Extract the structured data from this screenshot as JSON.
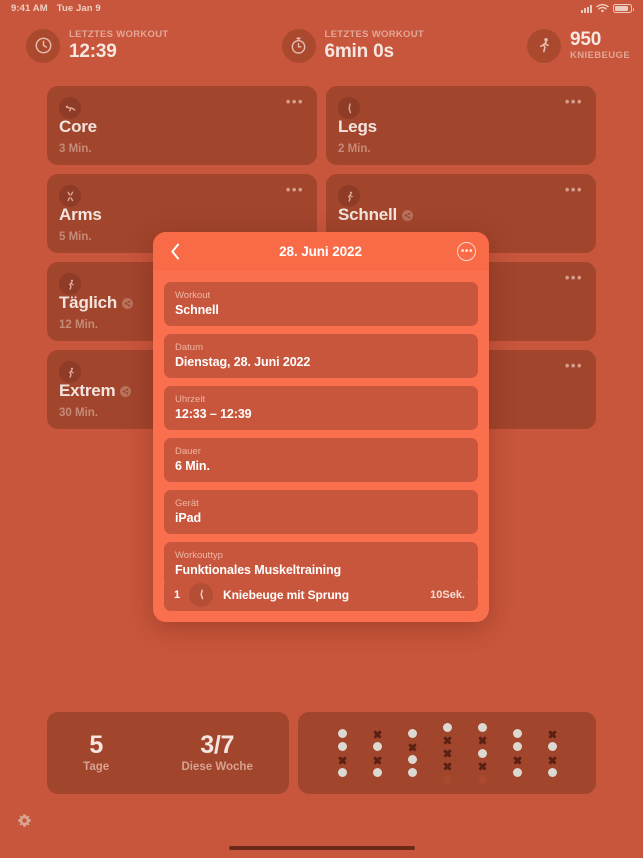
{
  "status_bar": {
    "time": "9:41 AM",
    "date": "Tue Jan 9",
    "icons": [
      "cellular-signal-icon",
      "wifi-icon",
      "battery-icon"
    ]
  },
  "top_stats": [
    {
      "icon": "clock-icon",
      "label": "LETZTES WORKOUT",
      "value": "12:39"
    },
    {
      "icon": "stopwatch-icon",
      "label": "LETZTES WORKOUT",
      "value": "6min 0s"
    },
    {
      "icon": "runner-icon",
      "value": "950",
      "label": "KNIEBEUGE"
    }
  ],
  "workout_cards": [
    {
      "icon": "plank-icon",
      "title": "Core",
      "duration": "3 Min.",
      "shared": false,
      "menu": "•••"
    },
    {
      "icon": "leg-raise-icon",
      "title": "Legs",
      "duration": "2 Min.",
      "shared": false,
      "menu": "•••"
    },
    {
      "icon": "arms-icon",
      "title": "Arms",
      "duration": "5 Min.",
      "shared": false,
      "menu": "•••"
    },
    {
      "icon": "squat-jump-icon",
      "title": "Schnell",
      "duration": "",
      "shared": true,
      "menu": "•••"
    },
    {
      "icon": "squat-jump-icon",
      "title": "Täglich",
      "duration": "12 Min.",
      "shared": true,
      "menu": "•••"
    },
    {
      "icon": "squat-jump-icon",
      "title": "Extrem",
      "duration": "30 Min.",
      "shared": true,
      "menu": "•••"
    }
  ],
  "modal": {
    "title": "28. Juni 2022",
    "back_icon": "chevron-left-icon",
    "more_icon": "ellipsis-circle-icon",
    "more_glyph": "•••",
    "fields": [
      {
        "label": "Workout",
        "value": "Schnell"
      },
      {
        "label": "Datum",
        "value": "Dienstag, 28. Juni 2022"
      },
      {
        "label": "Uhrzeit",
        "value": "12:33 – 12:39"
      },
      {
        "label": "Dauer",
        "value": "6 Min."
      },
      {
        "label": "Gerät",
        "value": "iPad"
      },
      {
        "label": "Workouttyp",
        "value": "Funktionales Muskeltraining"
      }
    ],
    "exercise": {
      "number": "1",
      "icon": "leg-raise-icon",
      "name": "Kniebeuge mit Sprung",
      "duration": "10Sek."
    }
  },
  "bottom": {
    "streak": {
      "number": "5",
      "label": "Tage"
    },
    "week": {
      "number": "3/7",
      "label": "Diese Woche"
    },
    "grid_legend": {
      "dot": "completed",
      "cross": "missed",
      "dim": "inactive"
    },
    "grid_columns": [
      [
        "dot",
        "dot",
        "cross",
        "dot"
      ],
      [
        "cross",
        "dot",
        "cross",
        "dot"
      ],
      [
        "dot",
        "cross",
        "dot",
        "dot"
      ],
      [
        "dot",
        "cross",
        "cross",
        "cross",
        "dim"
      ],
      [
        "dot",
        "cross",
        "dot",
        "cross",
        "dim"
      ],
      [
        "dot",
        "dot",
        "cross",
        "dot"
      ],
      [
        "cross",
        "dot",
        "cross",
        "dot"
      ]
    ]
  },
  "settings_icon": "gear-icon",
  "colors": {
    "background": "#c8563c",
    "card": "#a2452d",
    "modal": "#fa6f4d",
    "modal_field": "#c8563c",
    "text_primary": "#ffffff",
    "text_muted": "#e2a797"
  }
}
